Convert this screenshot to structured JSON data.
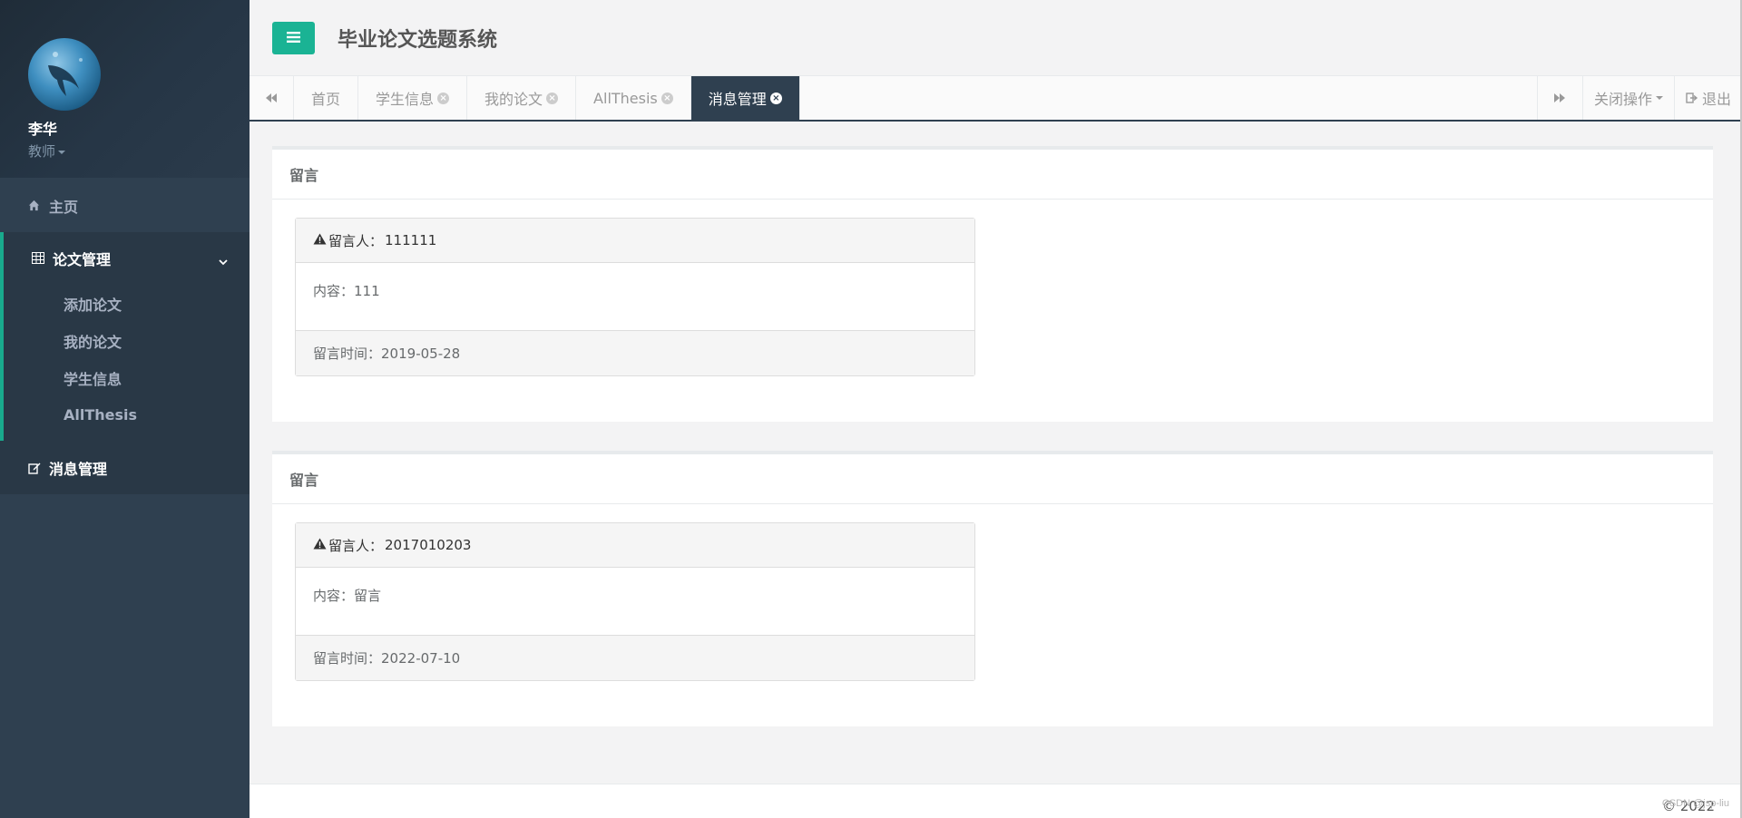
{
  "profile": {
    "name": "李华",
    "role": "教师"
  },
  "sidebar": {
    "home": "主页",
    "thesis_group": {
      "label": "论文管理",
      "items": [
        "添加论文",
        "我的论文",
        "学生信息",
        "AllThesis"
      ]
    },
    "messages": "消息管理"
  },
  "header": {
    "title": "毕业论文选题系统"
  },
  "tabs": {
    "items": [
      {
        "label": "首页",
        "closable": false,
        "active": false
      },
      {
        "label": "学生信息",
        "closable": true,
        "active": false
      },
      {
        "label": "我的论文",
        "closable": true,
        "active": false
      },
      {
        "label": "AllThesis",
        "closable": true,
        "active": false
      },
      {
        "label": "消息管理",
        "closable": true,
        "active": true
      }
    ],
    "close_ops": "关闭操作",
    "logout": "退出"
  },
  "messages": [
    {
      "title": "留言",
      "sender_label": "留言人：",
      "sender": "111111",
      "content_label": "内容：",
      "content": "111",
      "time_label": "留言时间：",
      "time": "2019-05-28"
    },
    {
      "title": "留言",
      "sender_label": "留言人：",
      "sender": "2017010203",
      "content_label": "内容：",
      "content": "留言",
      "time_label": "留言时间：",
      "time": "2022-07-10"
    }
  ],
  "footer": {
    "copyright": "© 2022",
    "watermark": "CSDN @jsp-liu"
  },
  "colors": {
    "sidebar_bg": "#2f4050",
    "accent": "#1ab394",
    "active_tab": "#2f4050"
  }
}
